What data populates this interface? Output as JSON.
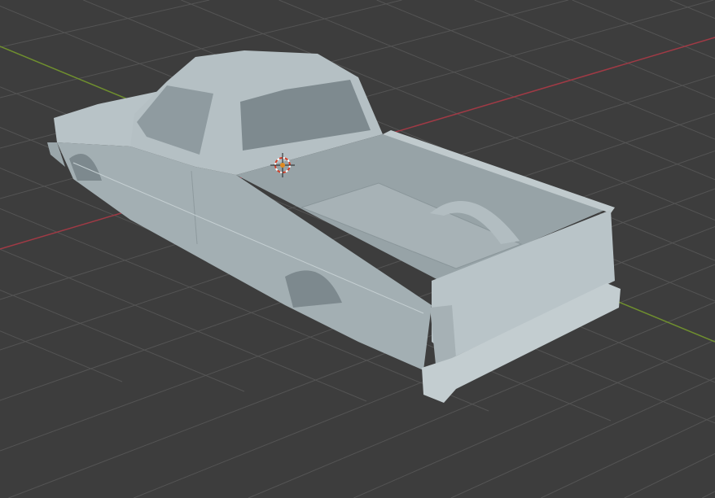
{
  "viewport": {
    "background_color": "#3d3d3d",
    "grid_color": "#545454",
    "x_axis_color": "#a03a45",
    "y_axis_color": "#6f8f2e"
  },
  "model": {
    "body_color": "#b3bfc3",
    "shadow_color": "#8e9a9e",
    "dark_color": "#6f7b80"
  },
  "icons": {
    "cursor": "3d-cursor-icon"
  }
}
